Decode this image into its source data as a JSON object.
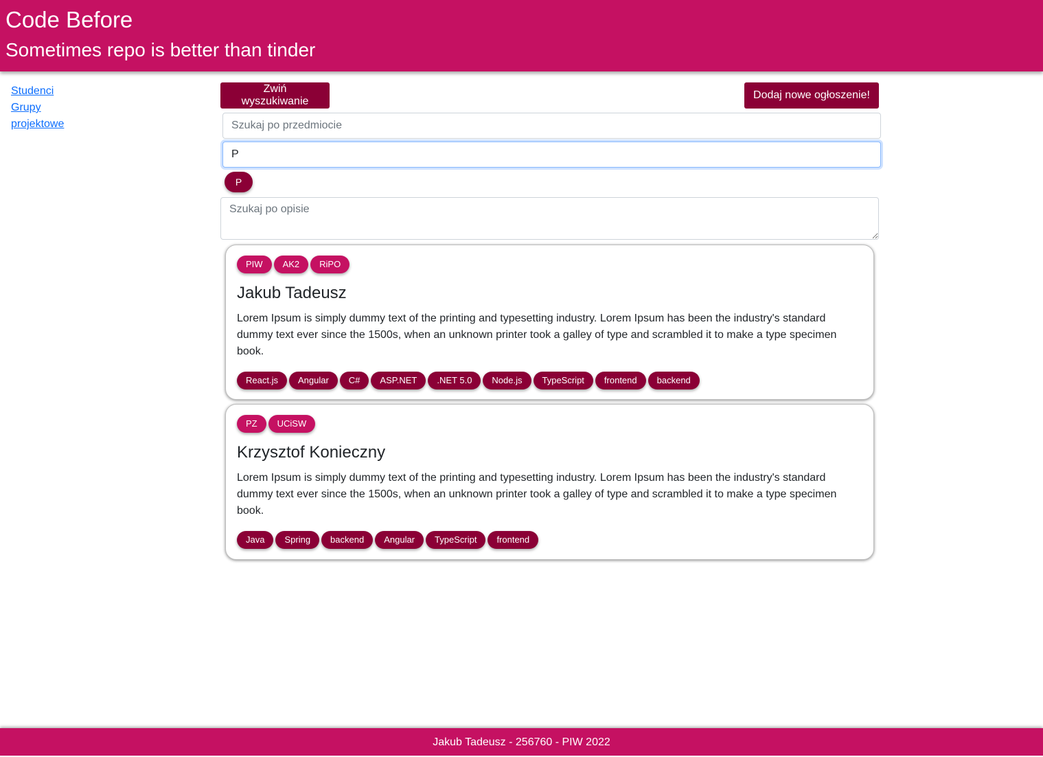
{
  "header": {
    "title": "Code Before",
    "subtitle": "Sometimes repo is better than tinder"
  },
  "sidebar": {
    "items": [
      {
        "label": "Studenci"
      },
      {
        "label": "Grupy projektowe"
      }
    ]
  },
  "toolbar": {
    "toggle_label": "Zwiń wyszukiwanie",
    "add_label": "Dodaj nowe ogłoszenie!"
  },
  "search": {
    "subject_placeholder": "Szukaj po przedmiocie",
    "subject_value": "",
    "tech_value": "P",
    "selected_tag": "P",
    "description_placeholder": "Szukaj po opisie"
  },
  "cards": [
    {
      "subjects": [
        "PIW",
        "AK2",
        "RiPO"
      ],
      "name": "Jakub Tadeusz",
      "description": "Lorem Ipsum is simply dummy text of the printing and typesetting industry. Lorem Ipsum has been the industry's standard dummy text ever since the 1500s, when an unknown printer took a galley of type and scrambled it to make a type specimen book.",
      "technologies": [
        "React.js",
        "Angular",
        "C#",
        "ASP.NET",
        ".NET 5.0",
        "Node.js",
        "TypeScript",
        "frontend",
        "backend"
      ]
    },
    {
      "subjects": [
        "PZ",
        "UCiSW"
      ],
      "name": "Krzysztof Konieczny",
      "description": "Lorem Ipsum is simply dummy text of the printing and typesetting industry. Lorem Ipsum has been the industry's standard dummy text ever since the 1500s, when an unknown printer took a galley of type and scrambled it to make a type specimen book.",
      "technologies": [
        "Java",
        "Spring",
        "backend",
        "Angular",
        "TypeScript",
        "frontend"
      ]
    }
  ],
  "footer": {
    "text": "Jakub Tadeusz - 256760 - PIW 2022"
  },
  "colors": {
    "brand": "#c51162",
    "brand_dark": "#8b0036",
    "link": "#0d6efd"
  }
}
